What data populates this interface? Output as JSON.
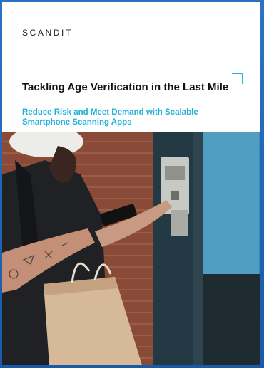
{
  "brand": {
    "logo_text": "SCANDIT"
  },
  "document": {
    "title": "Tackling Age Verification in the Last Mile",
    "subtitle": "Reduce Risk and Meet Demand with Scalable Smartphone Scanning Apps"
  },
  "colors": {
    "frame": "#1b5fae",
    "accent": "#1fb1d8",
    "title": "#111111"
  },
  "image": {
    "description_icon": "delivery-person-photo"
  }
}
